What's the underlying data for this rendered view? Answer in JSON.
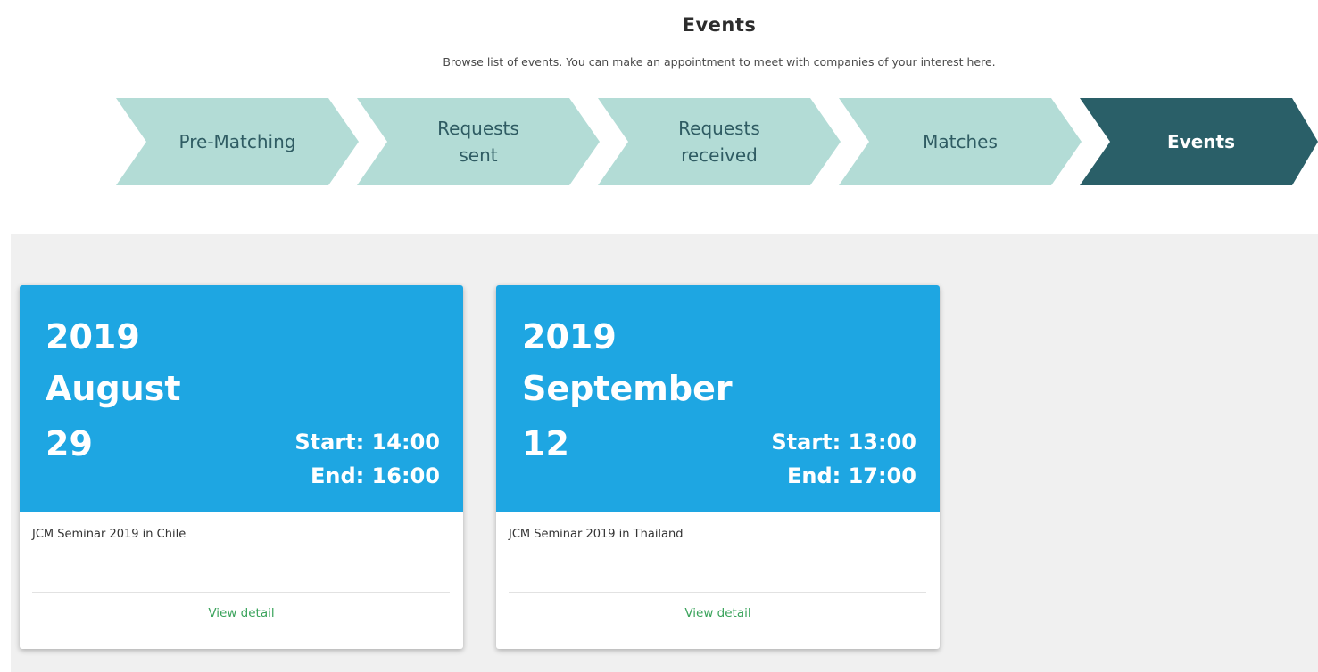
{
  "header": {
    "title": "Events",
    "subtitle": "Browse list of events. You can make an appointment to meet with companies of your interest here."
  },
  "steps": [
    {
      "label": "Pre-Matching",
      "active": false
    },
    {
      "label": "Requests\nsent",
      "active": false
    },
    {
      "label": "Requests\nreceived",
      "active": false
    },
    {
      "label": "Matches",
      "active": false
    },
    {
      "label": "Events",
      "active": true
    }
  ],
  "colors": {
    "step_inactive": "#b3dcd6",
    "step_active": "#2a5f68",
    "card_header": "#1ea6e2",
    "link": "#3aa35b",
    "area_background": "#f0f0f0"
  },
  "events": [
    {
      "year": "2019",
      "month": "August",
      "day": "29",
      "start": "Start: 14:00",
      "end": "End: 16:00",
      "title": "JCM Seminar 2019 in Chile",
      "link": "View detail"
    },
    {
      "year": "2019",
      "month": "September",
      "day": "12",
      "start": "Start: 13:00",
      "end": "End: 17:00",
      "title": "JCM Seminar 2019 in Thailand",
      "link": "View detail"
    }
  ]
}
